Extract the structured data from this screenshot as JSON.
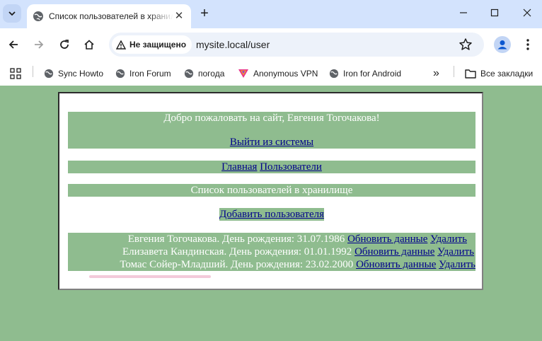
{
  "browser": {
    "tab_title": "Список пользователей в хранилище",
    "url": "mysite.local/user",
    "security_label": "Не защищено",
    "bookmarks": [
      {
        "label": "Sync Howto",
        "icon": "globe-icon"
      },
      {
        "label": "Iron Forum",
        "icon": "globe-icon"
      },
      {
        "label": "погода",
        "icon": "globe-icon"
      },
      {
        "label": "Anonymous VPN",
        "icon": "vpn-shield-icon"
      },
      {
        "label": "Iron for Android",
        "icon": "globe-icon"
      }
    ],
    "all_bookmarks_label": "Все закладки",
    "overflow_label": "»"
  },
  "page": {
    "welcome": "Добро пожаловать на сайт, Евгения Тогочакова!",
    "logout_link": "Выйти из системы",
    "nav": {
      "home": "Главная",
      "users": "Пользователи"
    },
    "heading": "Список пользователей в хранилище",
    "add_user_link": "Добавить пользователя",
    "users": [
      {
        "info": "Евгения Тогочакова. День рождения: 31.07.1986",
        "update": "Обновить данные",
        "delete": "Удалить"
      },
      {
        "info": "Елизавета Кандинская. День рождения: 01.01.1992",
        "update": "Обновить данные",
        "delete": "Удалить"
      },
      {
        "info": "Томас Сойер-Младший. День рождения: 23.02.2000",
        "update": "Обновить данные",
        "delete": "Удалить"
      }
    ]
  },
  "colors": {
    "page_background": "#8fbc8f",
    "link": "#00008b",
    "tabstrip": "#d3e3fd"
  }
}
